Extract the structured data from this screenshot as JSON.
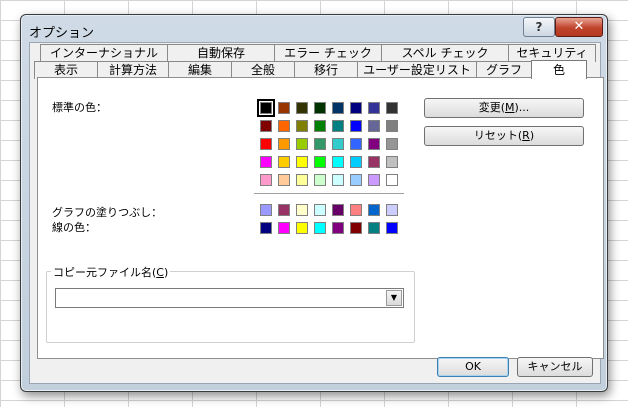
{
  "window": {
    "title": "オプション",
    "help_label": "?",
    "close_label": "✕"
  },
  "tabs_back": [
    "インターナショナル",
    "自動保存",
    "エラー チェック",
    "スペル チェック",
    "セキュリティ"
  ],
  "tabs_front": [
    "表示",
    "計算方法",
    "編集",
    "全般",
    "移行",
    "ユーザー設定リスト",
    "グラフ",
    "色"
  ],
  "active_tab": "色",
  "labels": {
    "standard_colors": "標準の色：",
    "chart_fills": "グラフの塗りつぶし：",
    "chart_lines": "線の色："
  },
  "buttons": {
    "modify_prefix": "変更(",
    "modify_key": "M",
    "modify_suffix": ")...",
    "reset_prefix": "リセット(",
    "reset_key": "R",
    "reset_suffix": ")",
    "ok": "OK",
    "cancel": "キャンセル"
  },
  "copy_group": {
    "legend_prefix": "コピー元ファイル名(",
    "legend_key": "C",
    "legend_suffix": ")",
    "value": ""
  },
  "colors": {
    "standard": [
      [
        "#000000",
        "#993300",
        "#333300",
        "#003300",
        "#003366",
        "#000080",
        "#333399",
        "#333333"
      ],
      [
        "#800000",
        "#FF6600",
        "#808000",
        "#008000",
        "#008080",
        "#0000FF",
        "#666699",
        "#808080"
      ],
      [
        "#FF0000",
        "#FF9900",
        "#99CC00",
        "#339966",
        "#33CCCC",
        "#3366FF",
        "#800080",
        "#969696"
      ],
      [
        "#FF00FF",
        "#FFCC00",
        "#FFFF00",
        "#00FF00",
        "#00FFFF",
        "#00CCFF",
        "#993366",
        "#C0C0C0"
      ],
      [
        "#FF99CC",
        "#FFCC99",
        "#FFFF99",
        "#CCFFCC",
        "#CCFFFF",
        "#99CCFF",
        "#CC99FF",
        "#FFFFFF"
      ]
    ],
    "chart_fills": [
      "#9999FF",
      "#993366",
      "#FFFFCC",
      "#CCFFFF",
      "#660066",
      "#FF8080",
      "#0066CC",
      "#CCCCFF"
    ],
    "chart_lines": [
      "#000080",
      "#FF00FF",
      "#FFFF00",
      "#00FFFF",
      "#800080",
      "#800000",
      "#008080",
      "#0000FF"
    ],
    "selected_standard": [
      0,
      0
    ]
  }
}
